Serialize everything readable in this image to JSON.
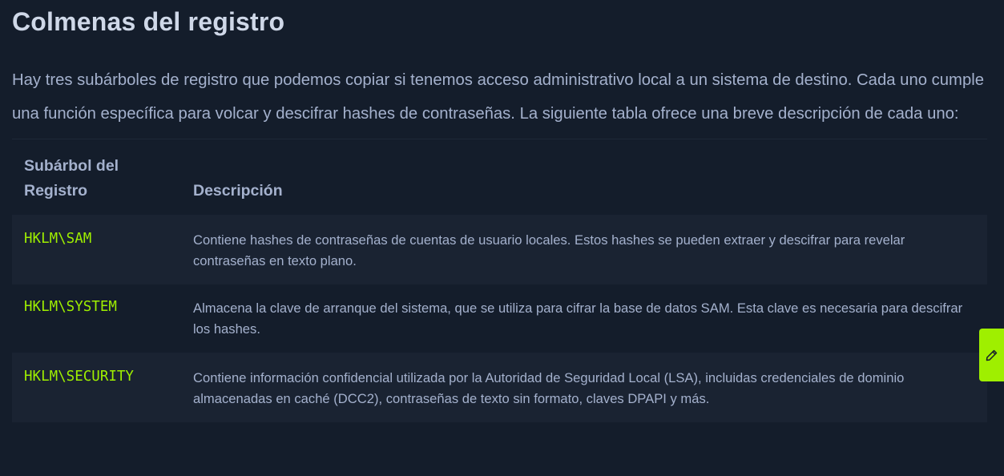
{
  "section": {
    "title": "Colmenas del registro",
    "intro": "Hay tres subárboles de registro que podemos copiar si tenemos acceso administrativo local a un sistema de destino. Cada uno cumple una función específica para volcar y descifrar hashes de contraseñas. La siguiente tabla ofrece una breve descripción de cada uno:"
  },
  "table": {
    "headers": {
      "hive": "Subárbol del Registro",
      "description": "Descripción"
    },
    "rows": [
      {
        "hive": "HKLM\\SAM",
        "description": "Contiene hashes de contraseñas de cuentas de usuario locales. Estos hashes se pueden extraer y descifrar para revelar contraseñas en texto plano."
      },
      {
        "hive": "HKLM\\SYSTEM",
        "description": "Almacena la clave de arranque del sistema, que se utiliza para cifrar la base de datos SAM. Esta clave es necesaria para descifrar los hashes."
      },
      {
        "hive": "HKLM\\SECURITY",
        "description": "Contiene información confidencial utilizada por la Autoridad de Seguridad Local (LSA), incluidas credenciales de dominio almacenadas en caché (DCC2), contraseñas de texto sin formato, claves DPAPI y más."
      }
    ]
  },
  "edit_tab": {
    "icon": "pencil-icon",
    "color": "#9fef00"
  },
  "colors": {
    "background": "#141d2b",
    "row_alt": "#1a2332",
    "text": "#a4b1cd",
    "heading": "#cfd8e8",
    "accent": "#9fef00"
  }
}
